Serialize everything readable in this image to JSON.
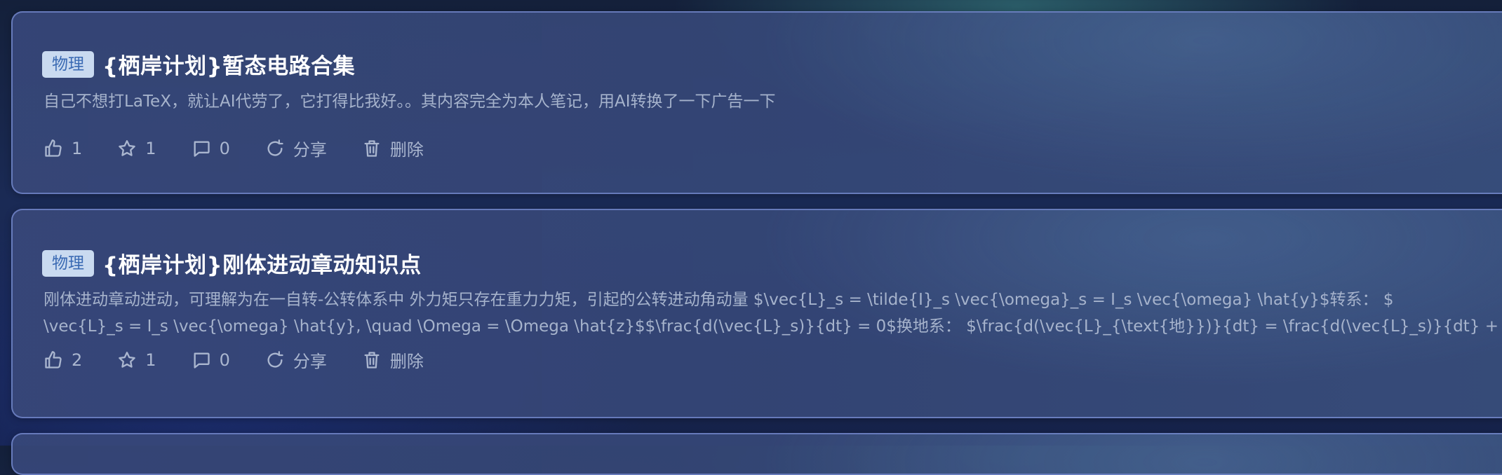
{
  "posts": [
    {
      "tag": "物理",
      "title": "{栖岸计划}暂态电路合集",
      "desc_lines": [
        "自己不想打LaTeX，就让AI代劳了，它打得比我好。。其内容完全为本人笔记，用AI转换了一下广告一下"
      ],
      "likes": "1",
      "stars": "1",
      "comments": "0",
      "share_label": "分享",
      "delete_label": "删除"
    },
    {
      "tag": "物理",
      "title": "{栖岸计划}刚体进动章动知识点",
      "desc_lines": [
        "刚体进动章动进动，可理解为在一自转-公转体系中  外力矩只存在重力力矩，引起的公转进动角动量  $\\vec{L}_s = \\tilde{I}_s \\vec{\\omega}_s = I_s \\vec{\\omega} \\hat{y}$转系：  $",
        "\\vec{L}_s = I_s \\vec{\\omega} \\hat{y}, \\quad \\Omega = \\Omega \\hat{z}$$\\frac{d(\\vec{L}_s)}{dt} = 0$换地系：  $\\frac{d(\\vec{L}_{\\text{地}})}{dt} = \\frac{d(\\vec{L}_s)}{dt} + …"
      ],
      "likes": "2",
      "stars": "1",
      "comments": "0",
      "share_label": "分享",
      "delete_label": "删除"
    }
  ],
  "icons": {
    "like": "thumbs-up-icon",
    "star": "star-icon",
    "comment": "comment-icon",
    "share": "share-icon",
    "delete": "trash-icon"
  }
}
